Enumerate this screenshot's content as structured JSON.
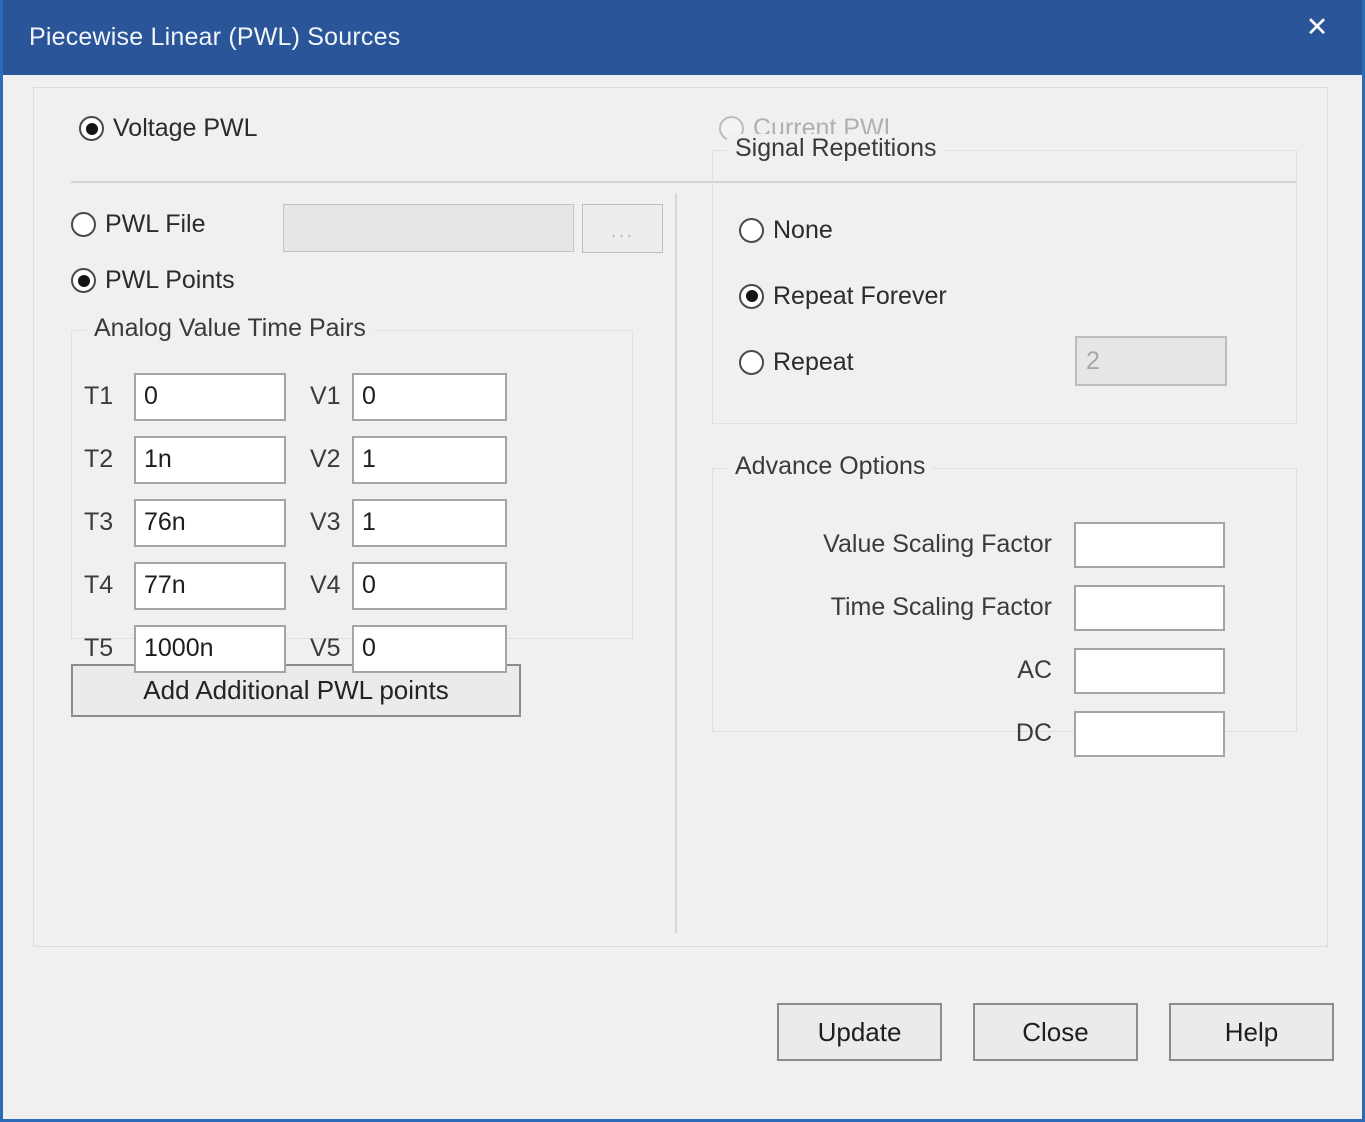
{
  "window": {
    "title": "Piecewise Linear (PWL) Sources",
    "close_icon": "close-icon",
    "close_glyph": "✕",
    "titlebar_color": "#2a5699",
    "border_color": "#2b6cb8",
    "background_color": "#f0f0f0"
  },
  "source_type": {
    "voltage": {
      "label": "Voltage PWL",
      "selected": true,
      "enabled": true
    },
    "current": {
      "label": "Current PWL",
      "selected": false,
      "enabled": false
    }
  },
  "input_mode": {
    "pwl_file": {
      "label": "PWL File",
      "selected": false,
      "field_value": "",
      "field_enabled": false,
      "browse_label": "...",
      "browse_icon": "ellipsis-icon"
    },
    "pwl_points": {
      "label": "PWL Points",
      "selected": true
    }
  },
  "analog_pairs": {
    "title": "Analog Value Time Pairs",
    "rows": [
      {
        "t_label": "T1",
        "t_value": "0",
        "v_label": "V1",
        "v_value": "0"
      },
      {
        "t_label": "T2",
        "t_value": "1n",
        "v_label": "V2",
        "v_value": "1"
      },
      {
        "t_label": "T3",
        "t_value": "76n",
        "v_label": "V3",
        "v_value": "1"
      },
      {
        "t_label": "T4",
        "t_value": "77n",
        "v_label": "V4",
        "v_value": "0"
      },
      {
        "t_label": "T5",
        "t_value": "1000n",
        "v_label": "V5",
        "v_value": "0"
      }
    ],
    "add_button_label": "Add Additional PWL points"
  },
  "signal_repetitions": {
    "title": "Signal Repetitions",
    "options": [
      {
        "label": "None",
        "selected": false
      },
      {
        "label": "Repeat Forever",
        "selected": true
      },
      {
        "label": "Repeat",
        "selected": false
      }
    ],
    "repeat_count_value": "2",
    "repeat_count_enabled": false
  },
  "advance_options": {
    "title": "Advance Options",
    "fields": [
      {
        "label": "Value Scaling Factor",
        "value": ""
      },
      {
        "label": "Time Scaling Factor",
        "value": ""
      },
      {
        "label": "AC",
        "value": ""
      },
      {
        "label": "DC",
        "value": ""
      }
    ]
  },
  "footer": {
    "update_label": "Update",
    "close_label": "Close",
    "help_label": "Help"
  }
}
